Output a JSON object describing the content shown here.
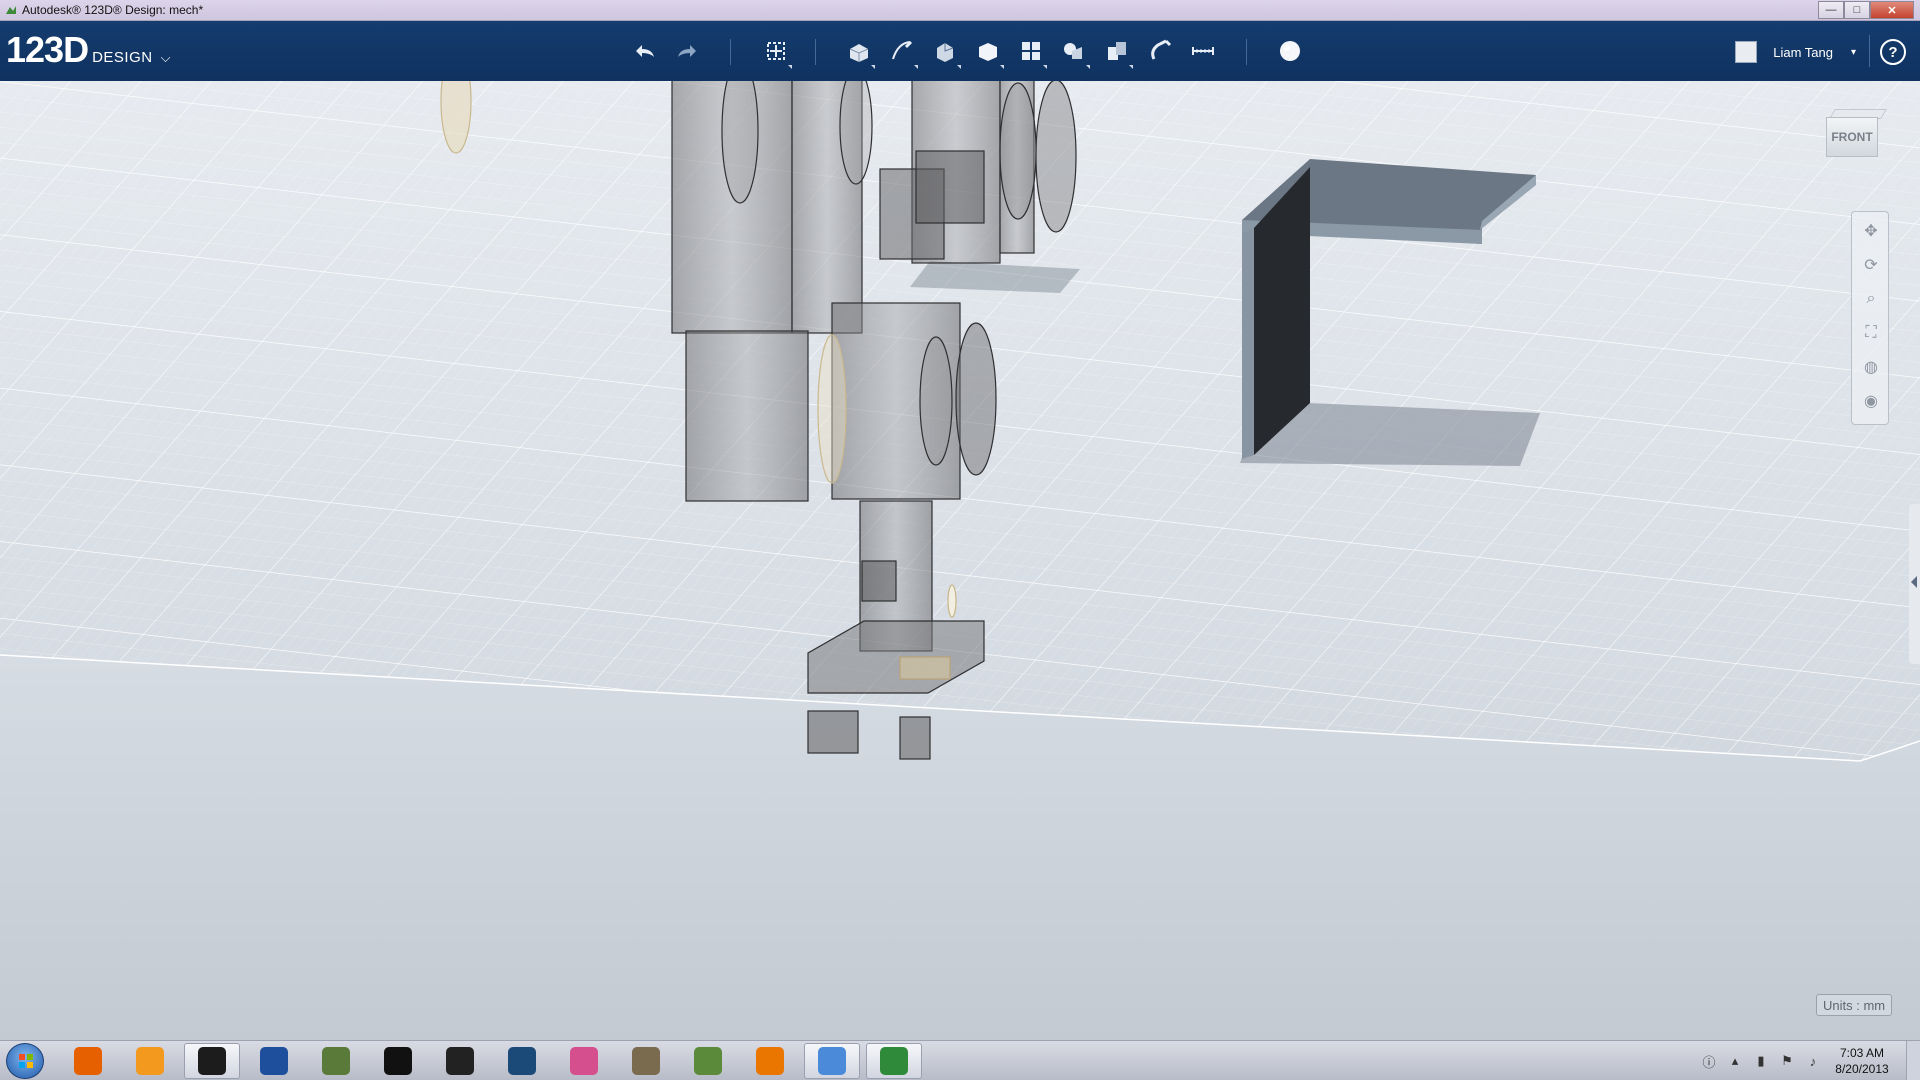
{
  "window": {
    "title": "Autodesk® 123D® Design: mech*"
  },
  "window_controls": {
    "minimize": "—",
    "maximize": "□",
    "close": "✕"
  },
  "app": {
    "brand_number": "123D",
    "brand_word": "DESIGN",
    "brand_menu_glyph": "⌵",
    "accent_color": "#143c6e"
  },
  "toolbar": {
    "tools": [
      {
        "name": "undo-icon"
      },
      {
        "name": "redo-icon"
      },
      {
        "name": "transform-icon"
      },
      {
        "name": "primitives-icon"
      },
      {
        "name": "sketch-icon"
      },
      {
        "name": "construct-icon"
      },
      {
        "name": "modify-icon"
      },
      {
        "name": "pattern-icon"
      },
      {
        "name": "grouping-icon"
      },
      {
        "name": "combine-icon"
      },
      {
        "name": "snap-icon"
      },
      {
        "name": "measure-icon"
      },
      {
        "name": "material-icon"
      }
    ]
  },
  "user": {
    "name": "Liam Tang",
    "caret": "▾"
  },
  "help": {
    "label": "?"
  },
  "viewcube": {
    "label": "FRONT"
  },
  "navbar": {
    "buttons": [
      {
        "name": "pan-icon"
      },
      {
        "name": "orbit-icon"
      },
      {
        "name": "zoom-icon"
      },
      {
        "name": "fit-icon"
      },
      {
        "name": "visual-style-icon"
      },
      {
        "name": "visibility-icon"
      }
    ]
  },
  "status": {
    "units": "Units : mm"
  },
  "taskbar": {
    "apps": [
      {
        "name": "firefox-icon",
        "color": "#e66000"
      },
      {
        "name": "media-player-icon",
        "color": "#f39a1e"
      },
      {
        "name": "hp-icon",
        "color": "#1c1c1c"
      },
      {
        "name": "task-icon",
        "color": "#1d4f9c"
      },
      {
        "name": "inkscape-icon",
        "color": "#5a7a3a"
      },
      {
        "name": "sketch-app-icon",
        "color": "#111111"
      },
      {
        "name": "pen-app-icon",
        "color": "#222222"
      },
      {
        "name": "butterfly-app-icon",
        "color": "#1c4a78"
      },
      {
        "name": "paint-app-icon",
        "color": "#d54f8f"
      },
      {
        "name": "gimp-icon",
        "color": "#7a6a4e"
      },
      {
        "name": "minecraft-icon",
        "color": "#5a8a3a"
      },
      {
        "name": "blender-icon",
        "color": "#ea7600"
      },
      {
        "name": "paint-palette-icon",
        "color": "#4b8ad8"
      },
      {
        "name": "123d-design-icon",
        "color": "#2f8a3a"
      }
    ]
  },
  "clock": {
    "time": "7:03 AM",
    "date": "8/20/2013"
  }
}
